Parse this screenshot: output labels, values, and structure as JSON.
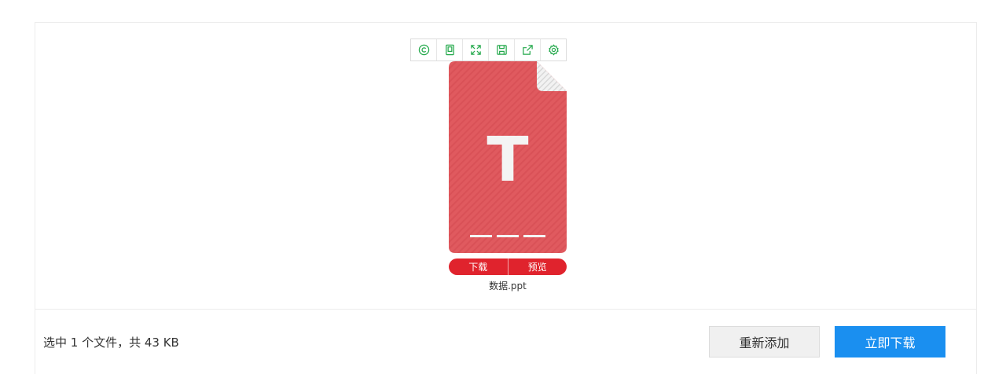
{
  "toolbar": {
    "icons": [
      "copyright-icon",
      "copy-icon",
      "expand-icon",
      "save-icon",
      "share-icon",
      "settings-icon"
    ],
    "accent": "#22a84a"
  },
  "file": {
    "letter": "T",
    "card_color": "#e05a5f",
    "name": "数据.ppt",
    "download_label": "下载",
    "preview_label": "预览",
    "action_color": "#e0232d"
  },
  "footer": {
    "summary": "选中 1 个文件，共 43 KB",
    "readd_label": "重新添加",
    "download_now_label": "立即下载",
    "primary_color": "#1a8ff0"
  }
}
